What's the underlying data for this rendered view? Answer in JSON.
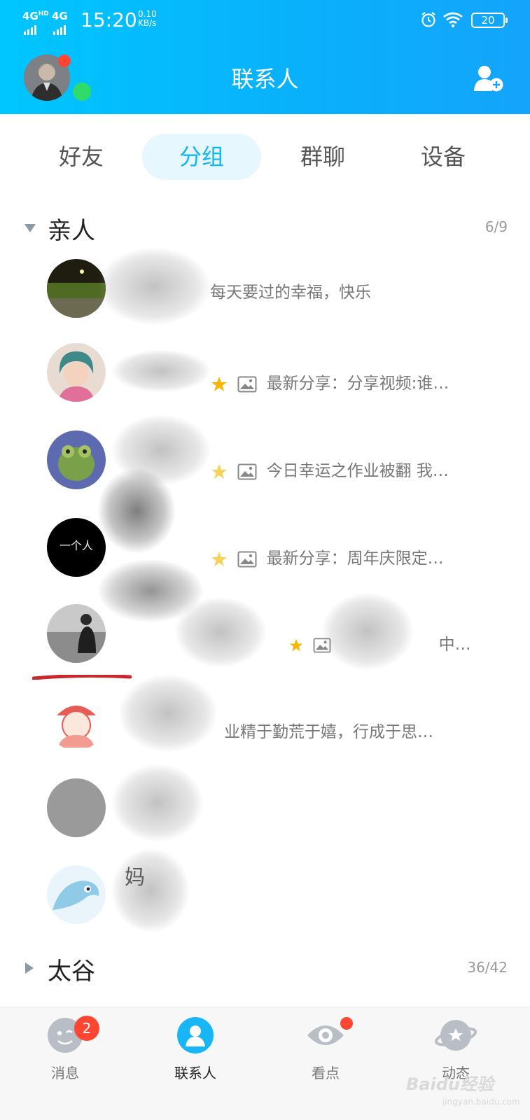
{
  "statusbar": {
    "sig1": "4G",
    "sig1_sup": "HD",
    "sig2": "4G",
    "time": "15:20",
    "speed_value": "0.10",
    "speed_unit": "KB/s",
    "battery": "20"
  },
  "header": {
    "title": "联系人"
  },
  "tabs": [
    {
      "label": "好友"
    },
    {
      "label": "分组"
    },
    {
      "label": "群聊"
    },
    {
      "label": "设备"
    }
  ],
  "groups": [
    {
      "name": "亲人",
      "count": "6/9",
      "expanded": true,
      "contacts": [
        {
          "name": "",
          "status": "每天要过的幸福，快乐",
          "avatar_color": "#3b3a20"
        },
        {
          "name": "",
          "status": "最新分享：分享视频:谁…",
          "avatar_color": "#d9b3a8"
        },
        {
          "name": "",
          "status": "今日幸运之作业被翻 我…",
          "avatar_color": "#6d8e4c"
        },
        {
          "name": "",
          "status": "最新分享：周年庆限定…",
          "avatar_color": "#000000",
          "avatar_text": "一个人"
        },
        {
          "name": "",
          "status": "中…",
          "avatar_color": "#8a8a8a"
        },
        {
          "name": "",
          "status": "业精于勤荒于嬉，行成于思…",
          "avatar_color": "#ffffff"
        },
        {
          "name": "",
          "status": "",
          "avatar_color": "#9a9a9a"
        },
        {
          "name": "妈",
          "status": "",
          "avatar_color": "#cfe9f5"
        }
      ]
    },
    {
      "name": "太谷",
      "count": "36/42",
      "expanded": false,
      "contacts": []
    }
  ],
  "bottom_nav": [
    {
      "label": "消息",
      "badge": "2"
    },
    {
      "label": "联系人"
    },
    {
      "label": "看点"
    },
    {
      "label": "动态"
    }
  ],
  "watermark": {
    "brand": "Baidu经验",
    "url": "jingyan.baidu.com"
  },
  "colors": {
    "accent": "#12b6f6",
    "header_start": "#00c6ff",
    "header_end": "#14a4fb",
    "badge": "#ff4632",
    "online": "#2fdc6a"
  }
}
